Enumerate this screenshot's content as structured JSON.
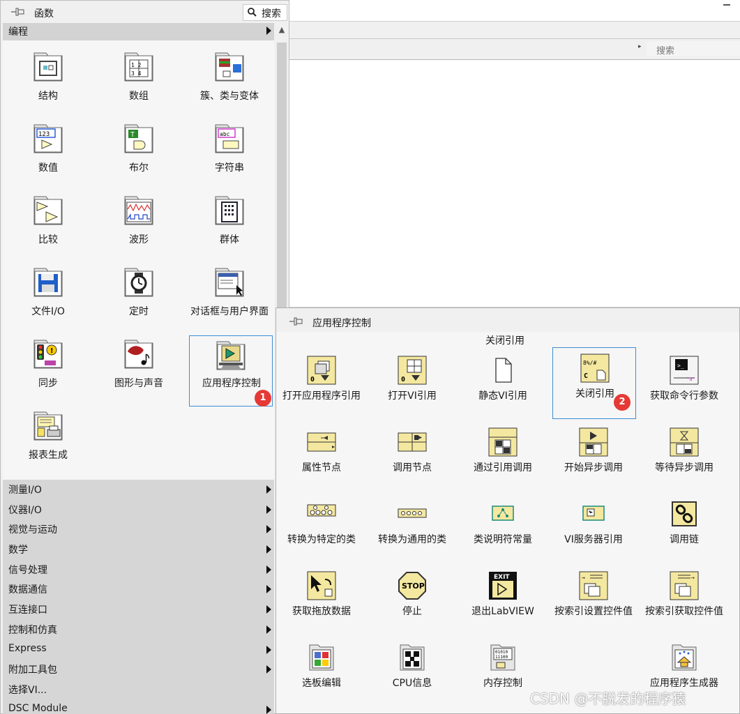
{
  "palette": {
    "title": "函数",
    "search_label": "搜索",
    "category": "编程",
    "items": [
      {
        "label": "结构",
        "icon": "structures-icon"
      },
      {
        "label": "数组",
        "icon": "array-icon"
      },
      {
        "label": "簇、类与变体",
        "icon": "cluster-class-variant-icon"
      },
      {
        "label": "数值",
        "icon": "numeric-icon"
      },
      {
        "label": "布尔",
        "icon": "boolean-icon"
      },
      {
        "label": "字符串",
        "icon": "string-icon"
      },
      {
        "label": "比较",
        "icon": "comparison-icon"
      },
      {
        "label": "波形",
        "icon": "waveform-icon"
      },
      {
        "label": "群体",
        "icon": "collection-icon"
      },
      {
        "label": "文件I/O",
        "icon": "file-io-icon"
      },
      {
        "label": "定时",
        "icon": "timing-icon"
      },
      {
        "label": "对话框与用户界面",
        "icon": "dialog-ui-icon"
      },
      {
        "label": "同步",
        "icon": "synchronization-icon"
      },
      {
        "label": "图形与声音",
        "icon": "graphics-sound-icon"
      },
      {
        "label": "应用程序控制",
        "icon": "application-control-icon",
        "badge": "1"
      },
      {
        "label": "报表生成",
        "icon": "report-generation-icon"
      }
    ],
    "categories": [
      "测量I/O",
      "仪器I/O",
      "视觉与运动",
      "数学",
      "信号处理",
      "数据通信",
      "互连接口",
      "控制和仿真",
      "Express",
      "附加工具包",
      "选择VI...",
      "DSC Module"
    ]
  },
  "background": {
    "search_placeholder": "搜索"
  },
  "subpalette": {
    "title": "应用程序控制",
    "tooltip": "关闭引用",
    "items": [
      {
        "label": "打开应用程序引用",
        "icon": "open-app-reference-icon"
      },
      {
        "label": "打开VI引用",
        "icon": "open-vi-reference-icon"
      },
      {
        "label": "静态VI引用",
        "icon": "static-vi-reference-icon"
      },
      {
        "label": "关闭引用",
        "icon": "close-reference-icon",
        "badge": "2"
      },
      {
        "label": "获取命令行参数",
        "icon": "command-line-args-icon"
      },
      {
        "label": "属性节点",
        "icon": "property-node-icon"
      },
      {
        "label": "调用节点",
        "icon": "invoke-node-icon"
      },
      {
        "label": "通过引用调用",
        "icon": "call-by-reference-icon"
      },
      {
        "label": "开始异步调用",
        "icon": "start-async-call-icon"
      },
      {
        "label": "等待异步调用",
        "icon": "wait-async-call-icon"
      },
      {
        "label": "转换为特定的类",
        "icon": "to-more-specific-class-icon"
      },
      {
        "label": "转换为通用的类",
        "icon": "to-more-generic-class-icon"
      },
      {
        "label": "类说明符常量",
        "icon": "class-specifier-constant-icon"
      },
      {
        "label": "VI服务器引用",
        "icon": "vi-server-reference-icon"
      },
      {
        "label": "调用链",
        "icon": "call-chain-icon"
      },
      {
        "label": "获取拖放数据",
        "icon": "get-drag-drop-data-icon"
      },
      {
        "label": "停止",
        "icon": "stop-icon"
      },
      {
        "label": "退出LabVIEW",
        "icon": "quit-labview-icon"
      },
      {
        "label": "按索引设置控件值",
        "icon": "set-control-value-icon"
      },
      {
        "label": "按索引获取控件值",
        "icon": "get-control-value-icon"
      },
      {
        "label": "选板编辑",
        "icon": "palette-editing-icon"
      },
      {
        "label": "CPU信息",
        "icon": "cpu-info-icon"
      },
      {
        "label": "内存控制",
        "icon": "memory-control-icon"
      },
      {
        "label": "应用程序生成器",
        "icon": "application-builder-icon"
      }
    ]
  },
  "watermark": "CSDN @不脱发的程序猿"
}
